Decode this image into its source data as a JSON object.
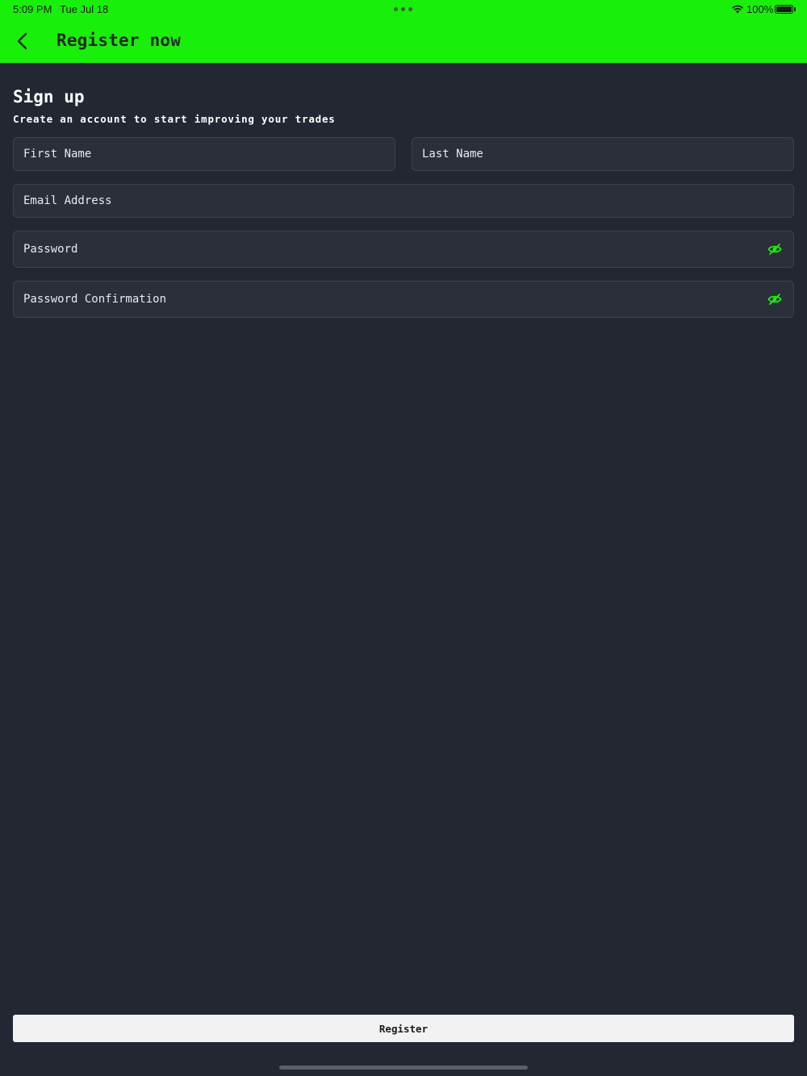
{
  "status_bar": {
    "time": "5:09 PM",
    "date": "Tue Jul 18",
    "battery": "100%",
    "battery_level": 1.0
  },
  "nav": {
    "title": "Register now",
    "back_icon": "chevron-left-icon"
  },
  "form": {
    "heading": "Sign up",
    "subheading": "Create an account to start improving your trades",
    "first_name_placeholder": "First Name",
    "last_name_placeholder": "Last Name",
    "email_placeholder": "Email Address",
    "password_placeholder": "Password",
    "password_confirmation_placeholder": "Password Confirmation",
    "visibility_icon": "eye-off-icon"
  },
  "actions": {
    "register_label": "Register"
  },
  "colors": {
    "accent": "#19f00a",
    "background": "#232732",
    "field_bg": "#2b2f3a",
    "button_bg": "#f2f2f2"
  }
}
